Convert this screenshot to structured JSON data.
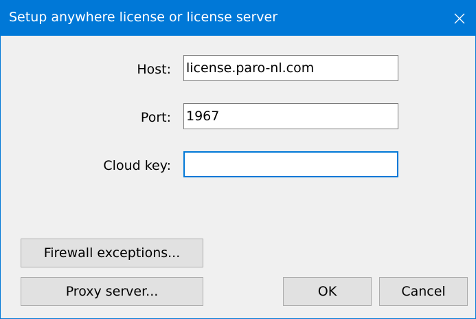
{
  "dialog": {
    "title": "Setup anywhere license or license server",
    "close_icon": "close-icon"
  },
  "fields": {
    "host": {
      "label": "Host:",
      "value": "license.paro-nl.com"
    },
    "port": {
      "label": "Port:",
      "value": "1967"
    },
    "cloud_key": {
      "label": "Cloud key:",
      "value": ""
    }
  },
  "buttons": {
    "firewall": "Firewall exceptions...",
    "proxy": "Proxy server...",
    "ok": "OK",
    "cancel": "Cancel"
  },
  "colors": {
    "accent": "#0078d7",
    "background": "#f0f0f0"
  }
}
